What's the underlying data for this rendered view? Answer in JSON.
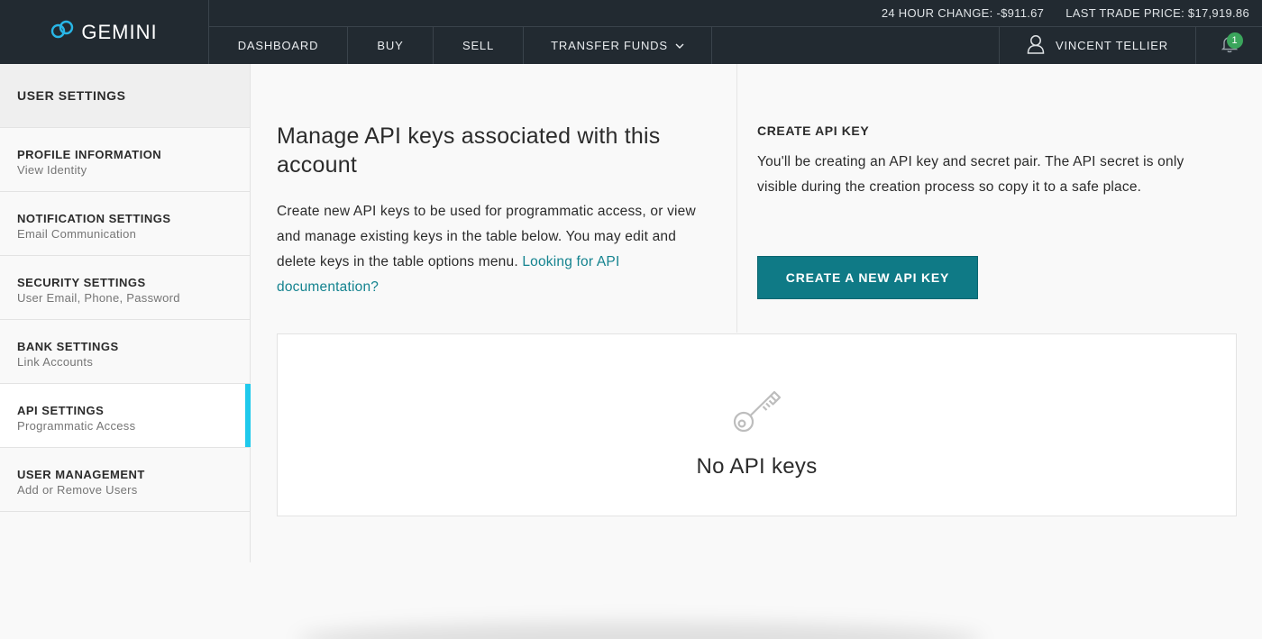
{
  "header": {
    "brand": "GEMINI",
    "ticker": {
      "change_label": "24 HOUR CHANGE:",
      "change_value": "-$911.67",
      "price_label": "LAST TRADE PRICE:",
      "price_value": "$17,919.86"
    },
    "nav": {
      "dashboard": "DASHBOARD",
      "buy": "BUY",
      "sell": "SELL",
      "transfer": "TRANSFER FUNDS",
      "user": "VINCENT TELLIER",
      "notification_count": "1"
    }
  },
  "sidebar": {
    "heading": "USER SETTINGS",
    "items": [
      {
        "title": "PROFILE INFORMATION",
        "subtitle": "View Identity"
      },
      {
        "title": "NOTIFICATION SETTINGS",
        "subtitle": "Email Communication"
      },
      {
        "title": "SECURITY SETTINGS",
        "subtitle": "User Email, Phone, Password"
      },
      {
        "title": "BANK SETTINGS",
        "subtitle": "Link Accounts"
      },
      {
        "title": "API SETTINGS",
        "subtitle": "Programmatic Access"
      },
      {
        "title": "USER MANAGEMENT",
        "subtitle": "Add or Remove Users"
      }
    ],
    "active_index": 4
  },
  "main": {
    "heading": "Manage API keys associated with this account",
    "description": "Create new API keys to be used for programmatic access, or view and manage existing keys in the table below. You may edit and delete keys in the table options menu.",
    "doc_link": "Looking for API documentation?",
    "create": {
      "title": "CREATE API KEY",
      "text": "You'll be creating an API key and secret pair. The API secret is only visible during the creation process so copy it to a safe place.",
      "button": "CREATE A NEW API KEY"
    },
    "empty_state": "No API keys"
  },
  "colors": {
    "header_bg": "#222a31",
    "accent_teal": "#0f7a86",
    "active_indicator": "#1fc9ec",
    "badge_green": "#3ba55c",
    "link": "#14838f"
  },
  "icons": [
    "gemini-logo-icon",
    "chevron-down-icon",
    "user-icon",
    "bell-icon",
    "key-icon"
  ]
}
